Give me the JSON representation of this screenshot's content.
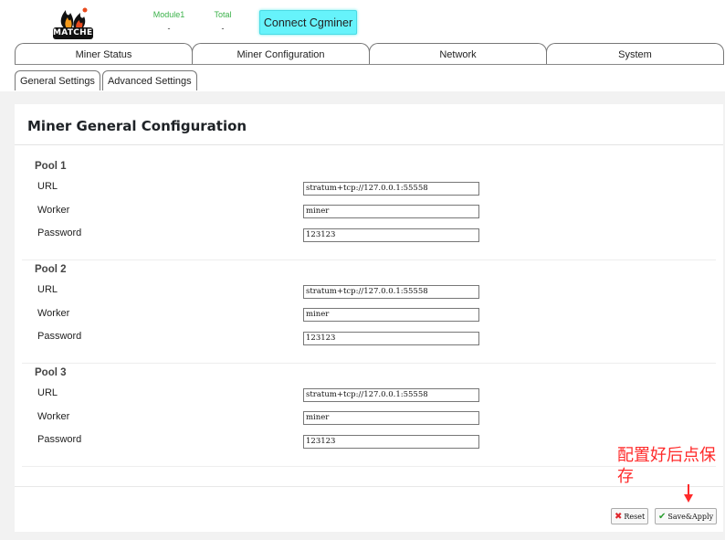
{
  "header": {
    "logo_text": "MATCHES",
    "stats": [
      {
        "label": "Module1",
        "value": "-"
      },
      {
        "label": "Total",
        "value": "-"
      }
    ],
    "connect_label": "Connect Cgminer"
  },
  "main_tabs": [
    "Miner Status",
    "Miner Configuration",
    "Network",
    "System"
  ],
  "sub_tabs": [
    "General Settings",
    "Advanced Settings"
  ],
  "panel": {
    "title": "Miner General Configuration",
    "field_labels": {
      "url": "URL",
      "worker": "Worker",
      "password": "Password"
    },
    "pools": [
      {
        "title": "Pool 1",
        "url": "stratum+tcp://127.0.0.1:55558",
        "worker": "miner",
        "password": "123123"
      },
      {
        "title": "Pool 2",
        "url": "stratum+tcp://127.0.0.1:55558",
        "worker": "miner",
        "password": "123123"
      },
      {
        "title": "Pool 3",
        "url": "stratum+tcp://127.0.0.1:55558",
        "worker": "miner",
        "password": "123123"
      }
    ]
  },
  "actions": {
    "reset_label": "Reset",
    "save_label": "Save&Apply"
  },
  "annotation": "配置好后点保存",
  "colors": {
    "accent_green": "#3bb24a",
    "connect_bg": "#66f3fb",
    "annotation_red": "#ff2a2a"
  }
}
